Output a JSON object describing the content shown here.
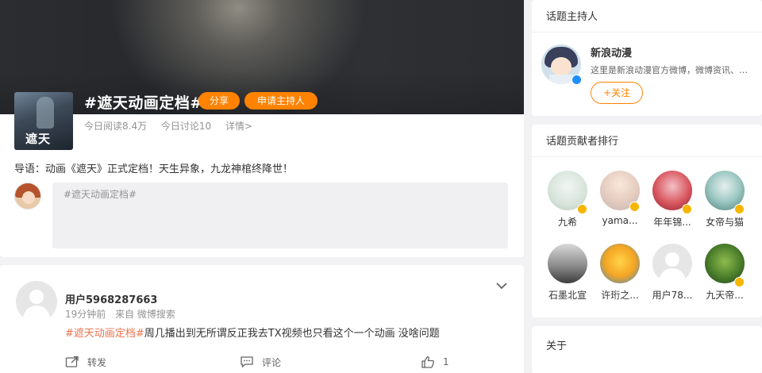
{
  "topic": {
    "title": "#遮天动画定档#",
    "share_label": "分享",
    "apply_host_label": "申请主持人",
    "cover_text": "遮天",
    "reads": "今日阅读8.4万",
    "discussions": "今日讨论10",
    "details_label": "详情>",
    "intro": "导语：动画《遮天》正式定档！天生异象，九龙神棺终降世！",
    "composer_placeholder": "#遮天动画定档#"
  },
  "post": {
    "user_name": "用户5968287663",
    "time": "19分钟前",
    "source": "来自 微博搜索",
    "tag": "#遮天动画定档#",
    "text": "周几播出到无所谓反正我去TX视频也只看这个一个动画 没啥问题",
    "repost_label": "转发",
    "comment_label": "评论",
    "like_count": "1"
  },
  "host_section": {
    "title": "话题主持人",
    "name": "新浪动漫",
    "desc": "这里是新浪动漫官方微博，微博资讯、动漫资讯",
    "follow_label": "+关注"
  },
  "rank_section": {
    "title": "话题贡献者排行",
    "contributors": [
      {
        "name": "九希",
        "badge": "gold"
      },
      {
        "name": "yama...",
        "badge": "gold"
      },
      {
        "name": "年年锦...",
        "badge": "gold"
      },
      {
        "name": "女帝与猫",
        "badge": "gold"
      },
      {
        "name": "石墨北宣",
        "badge": ""
      },
      {
        "name": "许珩之...",
        "badge": ""
      },
      {
        "name": "用户78...",
        "badge": ""
      },
      {
        "name": "九天帝...",
        "badge": "gold"
      }
    ]
  },
  "about_section": {
    "title": "关于"
  },
  "colors": {
    "accent": "#ff8200",
    "tag": "#eb7350",
    "verified_blue": "#1e90ff",
    "verified_gold": "#f8b500"
  }
}
